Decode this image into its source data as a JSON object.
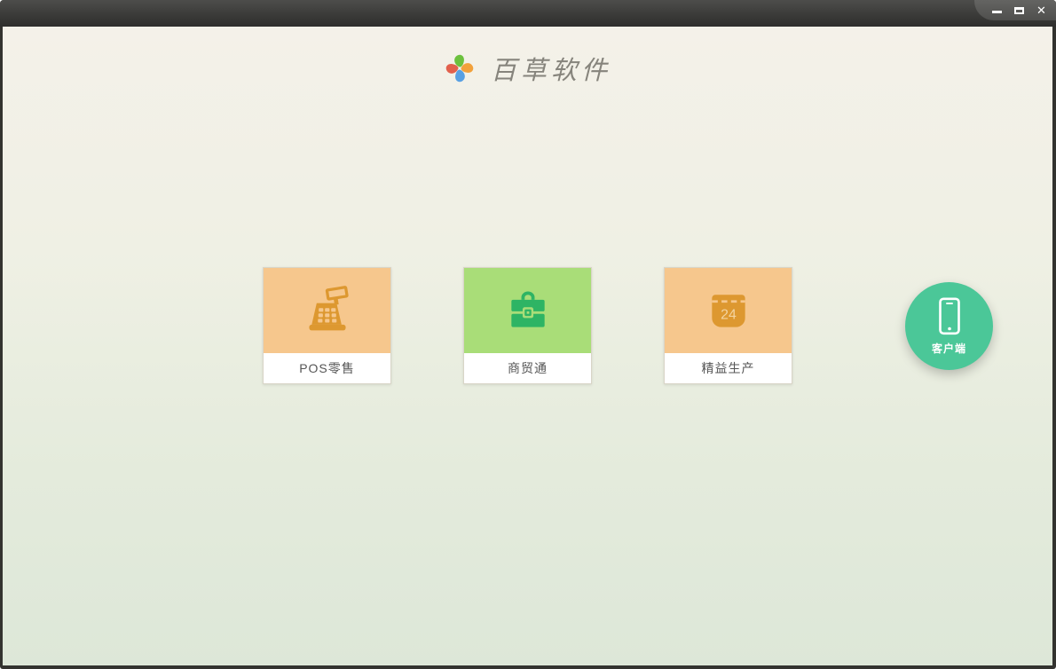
{
  "window": {
    "controls": {
      "minimize_icon": "minimize-icon",
      "maximize_icon": "maximize-icon",
      "close_icon": "close-icon",
      "close_glyph": "✕"
    },
    "titlebar_color_top": "#4d4d4b",
    "titlebar_color_bottom": "#2f2f2d"
  },
  "brand": {
    "name": "百草软件",
    "logo_icon": "pinwheel-logo-icon",
    "logo_colors": {
      "top_petal": "#6cc13d",
      "right_petal": "#f2a13b",
      "bottom_petal": "#58a0e3",
      "left_petal": "#e2604c"
    }
  },
  "products": [
    {
      "label": "POS零售",
      "icon": "cash-register-icon",
      "bg_color": "#f6c78d",
      "icon_color": "#dd9830"
    },
    {
      "label": "商贸通",
      "icon": "briefcase-icon",
      "bg_color": "#a9dd78",
      "icon_color": "#2eb464"
    },
    {
      "label": "精益生产",
      "icon": "calendar-icon",
      "icon_text": "24",
      "bg_color": "#f6c78d",
      "icon_color": "#dd9830"
    }
  ],
  "client_button": {
    "label": "客户端",
    "icon": "smartphone-icon",
    "bg_color": "#4bc798"
  }
}
